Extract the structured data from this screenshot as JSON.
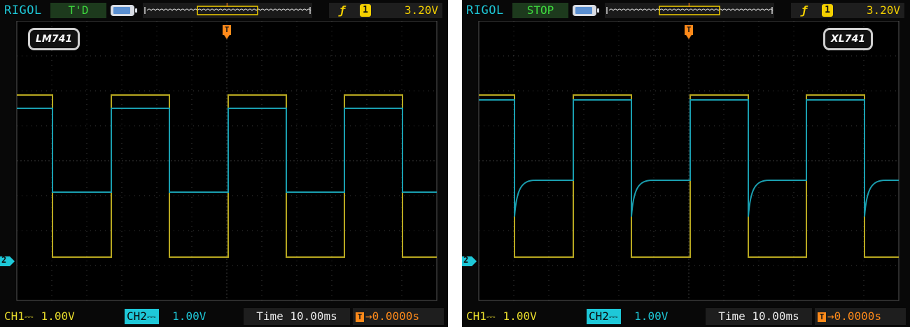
{
  "colors": {
    "ch1": "#b8a820",
    "ch2": "#1a9fb0",
    "accent": "#1ec8d8",
    "trigger": "#ff8a1a",
    "status": "#3edc3e"
  },
  "screens": [
    {
      "brand": "RIGOL",
      "status": "T'D",
      "trigger": {
        "edge_icon": "rising-edge-icon",
        "source": "1",
        "level": "3.20V"
      },
      "chip_label": "LM741",
      "ch1": {
        "name": "CH1",
        "scale": "1.00V"
      },
      "ch2": {
        "name": "CH2",
        "scale": "1.00V"
      },
      "timebase": "Time 10.00ms",
      "offset": "0.0000s"
    },
    {
      "brand": "RIGOL",
      "status": "STOP",
      "trigger": {
        "edge_icon": "rising-edge-icon",
        "source": "1",
        "level": "3.20V"
      },
      "chip_label": "XL741",
      "ch1": {
        "name": "CH1",
        "scale": "1.00V"
      },
      "ch2": {
        "name": "CH2",
        "scale": "1.00V"
      },
      "timebase": "Time 10.00ms",
      "offset": "0.0000s"
    }
  ]
}
